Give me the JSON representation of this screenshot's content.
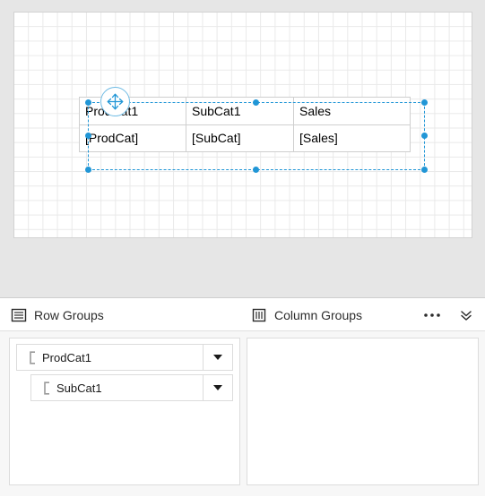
{
  "designer": {
    "tablix": {
      "name": "tablix-table",
      "header_row": [
        "ProdCat1",
        "SubCat1",
        "Sales"
      ],
      "detail_row": [
        "[ProdCat]",
        "[SubCat]",
        "[Sales]"
      ]
    },
    "selection": {
      "accent_color": "#2196d6",
      "move_handle_icon": "move-cross-icon",
      "handles": [
        "top-left",
        "top-middle",
        "top-right",
        "middle-left",
        "middle-right",
        "bottom-left",
        "bottom-middle",
        "bottom-right"
      ]
    },
    "canvas": {
      "background": "#ffffff",
      "grid_color": "#e9e9e9",
      "surface_background": "#e6e6e6"
    }
  },
  "groups_pane": {
    "row_groups": {
      "title": "Row Groups",
      "icon": "row-groups-icon",
      "items": [
        {
          "label": "ProdCat1",
          "level": 0,
          "icon": "group-bracket-icon",
          "dropdown": "chevron-down-icon"
        },
        {
          "label": "SubCat1",
          "level": 1,
          "icon": "group-bracket-icon",
          "dropdown": "chevron-down-icon"
        }
      ]
    },
    "column_groups": {
      "title": "Column Groups",
      "icon": "column-groups-icon",
      "items": []
    },
    "actions": {
      "more_label": "More options",
      "more_icon": "ellipsis-icon",
      "expand_label": "Expand",
      "expand_icon": "double-chevron-down-icon"
    }
  }
}
